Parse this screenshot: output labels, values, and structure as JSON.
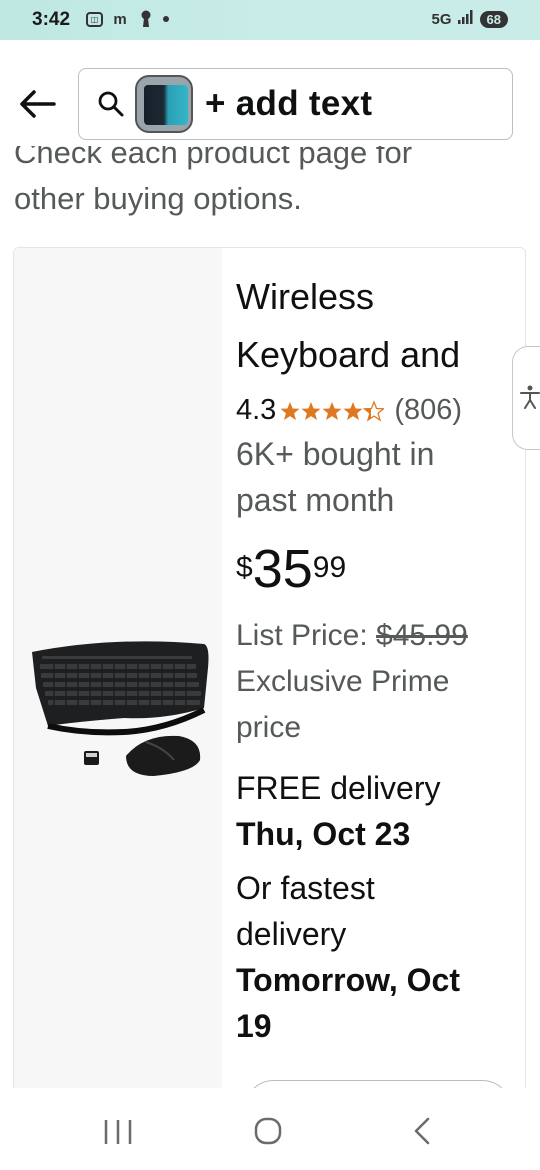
{
  "status_bar": {
    "time": "3:42",
    "network": "5G",
    "battery": "68"
  },
  "header": {
    "search_text": "+ add text"
  },
  "results_note": {
    "line1_partial": "Check each product page for",
    "line2": "other buying options."
  },
  "product": {
    "title_line1": "Wireless",
    "title_line2": "Keyboard and",
    "rating": "4.3",
    "stars_value": 4.3,
    "rating_count": "(806)",
    "bought_line1": "6K+ bought in",
    "bought_line2": "past month",
    "price_symbol": "$",
    "price_whole": "35",
    "price_fraction": "99",
    "list_price_label": "List Price: ",
    "list_price_value": "$45.99",
    "exclusive_line1": "Exclusive Prime",
    "exclusive_line2": "price",
    "free_delivery": "FREE delivery",
    "delivery_date": "Thu, Oct 23",
    "fastest_line1": "Or fastest",
    "fastest_line2": "delivery",
    "fastest_date_line1": "Tomorrow, Oct",
    "fastest_date_line2": "19"
  },
  "colors": {
    "star": "#de7921",
    "secondary_text": "#565959",
    "primary_text": "#0f1111"
  },
  "icons": {
    "back": "arrow-left-icon",
    "search": "search-icon",
    "accessibility": "accessibility-icon",
    "nav_recents": "recents-icon",
    "nav_home": "home-icon",
    "nav_back": "back-icon"
  }
}
